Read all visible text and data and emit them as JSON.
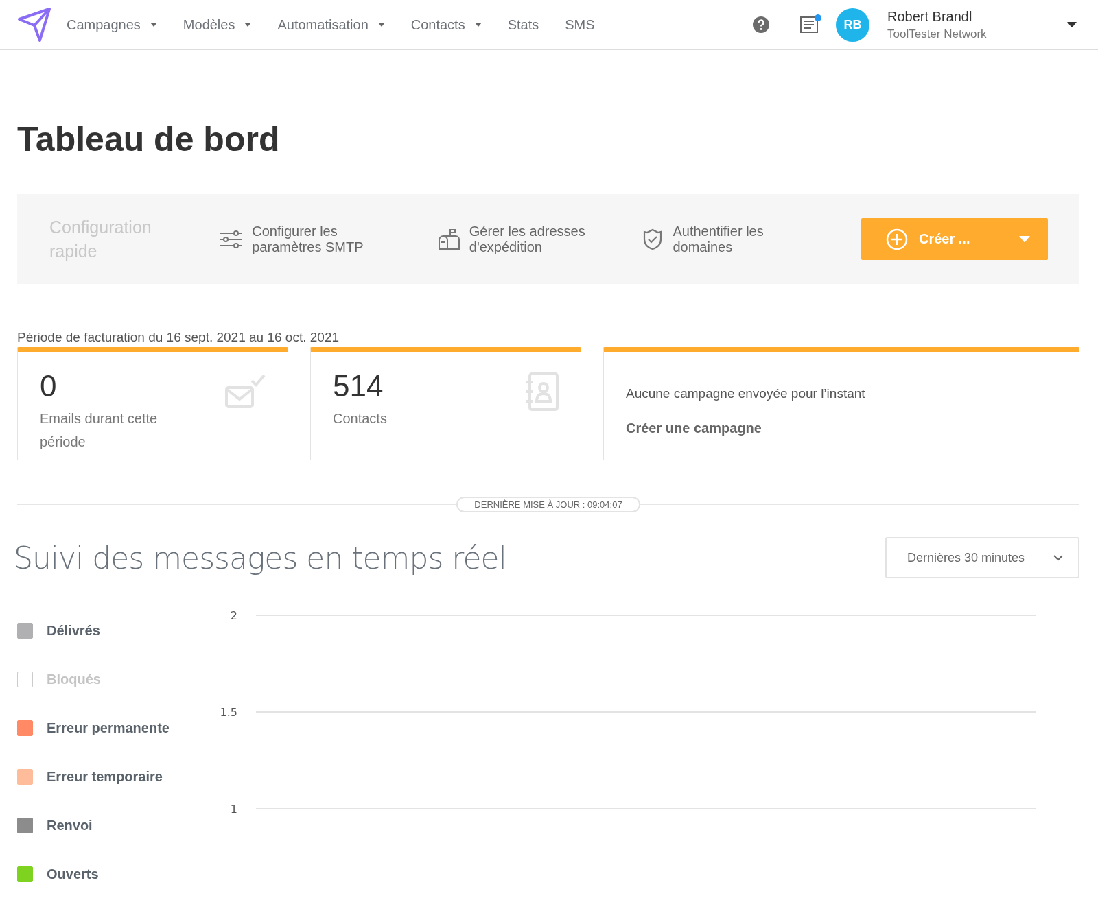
{
  "nav": {
    "menu": [
      {
        "label": "Campagnes",
        "dropdown": true
      },
      {
        "label": "Modèles",
        "dropdown": true
      },
      {
        "label": "Automatisation",
        "dropdown": true
      },
      {
        "label": "Contacts",
        "dropdown": true
      },
      {
        "label": "Stats",
        "dropdown": false
      },
      {
        "label": "SMS",
        "dropdown": false
      }
    ],
    "has_unread": true,
    "user": {
      "initials": "RB",
      "name": "Robert Brandl",
      "account": "ToolTester Network"
    }
  },
  "page_title": "Tableau de bord",
  "quick_config": {
    "title": "Configuration rapide",
    "actions": [
      {
        "kind": "smtp",
        "label": "Configurer les paramètres SMTP"
      },
      {
        "kind": "senders",
        "label": "Gérer les adresses d'expédition"
      },
      {
        "kind": "domains",
        "label": "Authentifier les domaines"
      }
    ],
    "create_button": "Créer ..."
  },
  "billing_period": "Période de facturation du 16 sept. 2021 au 16 oct. 2021",
  "stat_cards": [
    {
      "kind": "emails",
      "value": "0",
      "label": "Emails durant cette période"
    },
    {
      "kind": "contacts",
      "value": "514",
      "label": "Contacts"
    },
    {
      "kind": "campaigns",
      "message": "Aucune campagne envoyée pour l’instant",
      "link": "Créer une campagne"
    }
  ],
  "last_update": "DERNIÈRE MISE À JOUR : 09:04:07",
  "realtime": {
    "title": "Suivi des messages en temps réel",
    "period_select": {
      "value": "Dernières 30 minutes"
    },
    "legend": [
      {
        "label": "Délivrés",
        "color": "#b0b0b2",
        "checked": true
      },
      {
        "label": "Bloqués",
        "color": "#cccccc",
        "checked": false
      },
      {
        "label": "Erreur permanente",
        "color": "#ff8a65",
        "checked": true
      },
      {
        "label": "Erreur temporaire",
        "color": "#ffbc9a",
        "checked": true
      },
      {
        "label": "Renvoi",
        "color": "#8c8c8c",
        "checked": true
      },
      {
        "label": "Ouverts",
        "color": "#7ed321",
        "checked": true
      }
    ],
    "chart": {
      "axis_labels": [
        "2",
        "1.5",
        "1"
      ]
    }
  }
}
